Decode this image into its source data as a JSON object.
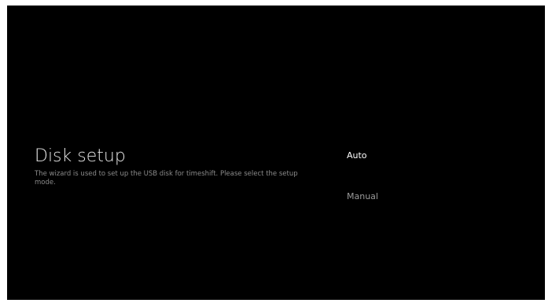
{
  "screen": {
    "title": "Disk setup",
    "description": "The wizard is used to set up the USB disk for timeshift. Please select the setup mode."
  },
  "options": [
    {
      "label": "Auto",
      "selected": true
    },
    {
      "label": "Manual",
      "selected": false
    }
  ],
  "colors": {
    "background": "#000000",
    "title": "#e6e6e6",
    "description": "#8a8a8a",
    "option_selected": "#ffffff",
    "option_unselected": "#9a9a9a"
  }
}
